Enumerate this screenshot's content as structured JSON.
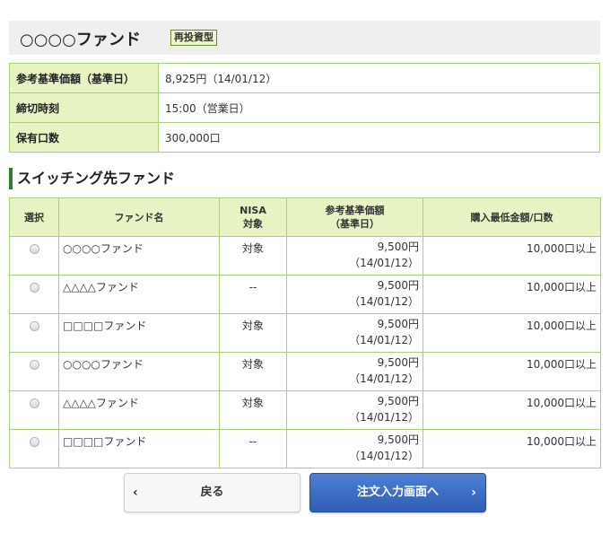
{
  "fund": {
    "name": "○○○○ファンド",
    "badge": "再投資型"
  },
  "info": [
    {
      "label": "参考基準価額（基準日）",
      "value": "8,925円（14/01/12）"
    },
    {
      "label": "締切時刻",
      "value": "15:00（営業日）"
    },
    {
      "label": "保有口数",
      "value": "300,000口"
    }
  ],
  "section_title": "スイッチング先ファンド",
  "table": {
    "headers": {
      "select": "選択",
      "fund_name": "ファンド名",
      "nisa_line1": "NISA",
      "nisa_line2": "対象",
      "price_line1": "参考基準価額",
      "price_line2": "（基準日）",
      "min": "購入最低金額/口数"
    },
    "rows": [
      {
        "name": "○○○○ファンド",
        "nisa": "対象",
        "price": "9,500円",
        "date": "（14/01/12）",
        "min": "10,000口以上"
      },
      {
        "name": "△△△△ファンド",
        "nisa": "--",
        "price": "9,500円",
        "date": "（14/01/12）",
        "min": "10,000口以上"
      },
      {
        "name": "□□□□ファンド",
        "nisa": "対象",
        "price": "9,500円",
        "date": "（14/01/12）",
        "min": "10,000口以上"
      },
      {
        "name": "○○○○ファンド",
        "nisa": "対象",
        "price": "9,500円",
        "date": "（14/01/12）",
        "min": "10,000口以上"
      },
      {
        "name": "△△△△ファンド",
        "nisa": "対象",
        "price": "9,500円",
        "date": "（14/01/12）",
        "min": "10,000口以上"
      },
      {
        "name": "□□□□ファンド",
        "nisa": "--",
        "price": "9,500円",
        "date": "（14/01/12）",
        "min": "10,000口以上"
      }
    ]
  },
  "buttons": {
    "back": "戻る",
    "next": "注文入力画面へ",
    "back_icon": "chevron-left-icon",
    "next_icon": "chevron-right-icon"
  },
  "colors": {
    "header_bg": "#efefef",
    "label_bg": "#e7f3c3",
    "border": "#a9cf7c",
    "section_accent": "#2e7d32",
    "primary_button": "#3a6cc6"
  }
}
